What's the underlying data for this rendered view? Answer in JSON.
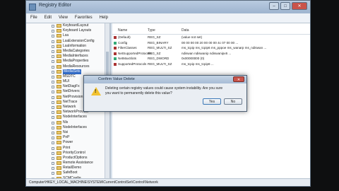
{
  "window": {
    "title": "Registry Editor",
    "menu": [
      "File",
      "Edit",
      "View",
      "Favorites",
      "Help"
    ]
  },
  "tree": {
    "items": [
      {
        "label": "KeyboardLayout"
      },
      {
        "label": "Keyboard Layouts"
      },
      {
        "label": "Lsa"
      },
      {
        "label": "LsaExtensionConfig"
      },
      {
        "label": "LsaInformation"
      },
      {
        "label": "MediaCategories"
      },
      {
        "label": "MediaInterfaces"
      },
      {
        "label": "MediaProperties"
      },
      {
        "label": "MediaResources"
      },
      {
        "label": "MediaSets"
      },
      {
        "label": "MSDTC"
      },
      {
        "label": "MUI"
      },
      {
        "label": "NetDiagFx"
      },
      {
        "label": "NetDrivers"
      },
      {
        "label": "NetProvision"
      },
      {
        "label": "NetTrace"
      },
      {
        "label": "Network"
      },
      {
        "label": "NetworkProvider"
      },
      {
        "label": "NodeInterfaces"
      },
      {
        "label": "Nls"
      },
      {
        "label": "NodeInterfaces"
      },
      {
        "label": "Nsi"
      },
      {
        "label": "PnP"
      },
      {
        "label": "Power"
      },
      {
        "label": "Print"
      },
      {
        "label": "PriorityControl"
      },
      {
        "label": "ProductOptions"
      },
      {
        "label": "Remote Assistance"
      },
      {
        "label": "RetailDemo"
      },
      {
        "label": "SafeBoot"
      },
      {
        "label": "SCMConfig"
      },
      {
        "label": "ScsiPort"
      }
    ],
    "selected_index": 9
  },
  "values": {
    "headers": {
      "name": "Name",
      "type": "Type",
      "data": "Data"
    },
    "rows": [
      {
        "name": "(Default)",
        "type": "REG_SZ",
        "data": "(value not set)",
        "kind": "string"
      },
      {
        "name": "Config",
        "type": "REG_BINARY",
        "data": "00 00 00 00 20 00 00 00 4c 07 00 00 ...",
        "kind": "binary"
      },
      {
        "name": "FilterClasses",
        "type": "REG_MULTI_SZ",
        "data": "ms_tcpip ms_tcpip6 ms_pppoe ms_wanarp ms_ndiswan ...",
        "kind": "string"
      },
      {
        "name": "NetSupportedProtocols",
        "type": "REG_SZ",
        "data": "ndiswan ndiswanip ndiswanipv6 ...",
        "kind": "string"
      },
      {
        "name": "NetMaxSlots",
        "type": "REG_DWORD",
        "data": "0x00000000 (0)",
        "kind": "binary"
      },
      {
        "name": "SupportedProtocols",
        "type": "REG_MULTI_SZ",
        "data": "ms_tcpip ms_tcpip6 ...",
        "kind": "string"
      }
    ]
  },
  "status": {
    "path": "Computer\\HKEY_LOCAL_MACHINE\\SYSTEM\\CurrentControlSet\\Control\\Network"
  },
  "dialog": {
    "title": "Confirm Value Delete",
    "message": "Deleting certain registry values could cause system instability. Are you sure you want to permanently delete this value?",
    "yes_label": "Yes",
    "no_label": "No"
  }
}
